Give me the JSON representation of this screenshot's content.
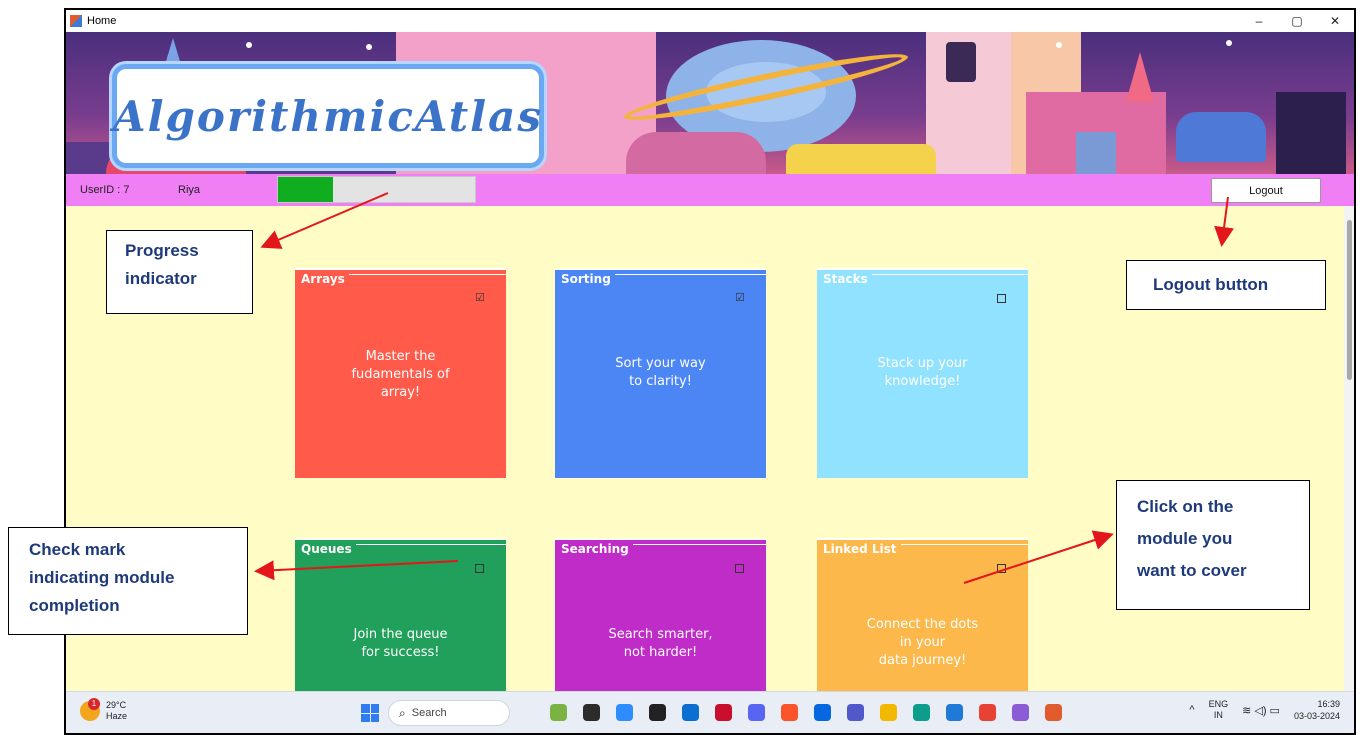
{
  "window": {
    "title": "Home",
    "controls": {
      "minimize": "–",
      "maximize": "▢",
      "close": "✕"
    }
  },
  "banner": {
    "logo_text": "AlgorithmicAtlas"
  },
  "userbar": {
    "user_id_label": "UserID : 7",
    "user_name": "Riya",
    "progress_percent": 28,
    "progress_color": "#0fad1f",
    "logout_label": "Logout"
  },
  "modules": [
    {
      "title": "Arrays",
      "text": "Master the\nfudamentals of\narray!",
      "completed": true,
      "color": "#ff5a4a"
    },
    {
      "title": "Sorting",
      "text": "Sort your way\nto clarity!",
      "completed": true,
      "color": "#4c86f5"
    },
    {
      "title": "Stacks",
      "text": "Stack up your\nknowledge!",
      "completed": false,
      "color": "#91e2ff"
    },
    {
      "title": "Queues",
      "text": "Join the queue\nfor success!",
      "completed": false,
      "color": "#20a05a"
    },
    {
      "title": "Searching",
      "text": "Search smarter,\nnot harder!",
      "completed": false,
      "color": "#c02cc8"
    },
    {
      "title": "Linked List",
      "text": "Connect the dots\nin your\ndata journey!",
      "completed": false,
      "color": "#fdb84b"
    }
  ],
  "callouts": {
    "progress": "Progress\nindicator",
    "logout": "Logout button",
    "checkmark": "Check mark\nindicating module\ncompletion",
    "module": "Click on the\nmodule you\nwant to cover"
  },
  "taskbar": {
    "weather_temp": "29°C",
    "weather_desc": "Haze",
    "weather_badge": "1",
    "search_placeholder": "Search",
    "lang_top": "ENG",
    "lang_bottom": "IN",
    "time": "16:39",
    "date": "03-03-2024",
    "app_icons": [
      "widgets-icon",
      "file-explorer-icon",
      "zoom-icon",
      "dell-icon",
      "store-icon",
      "mcafee-icon",
      "discord-icon",
      "brave-icon",
      "meta-icon",
      "teams-icon",
      "folder-icon",
      "edge-icon",
      "vscode-icon",
      "chrome-icon",
      "vs-icon",
      "winforms-icon"
    ],
    "app_icon_colors": [
      "#7bb342",
      "#2c2c2c",
      "#2d8cff",
      "#222222",
      "#0a6fd1",
      "#c8102e",
      "#5865f2",
      "#fb542b",
      "#0668e1",
      "#5059c9",
      "#f2b900",
      "#0c9d8c",
      "#1e7ad6",
      "#e84235",
      "#8a5cd6",
      "#e25b2c"
    ]
  }
}
